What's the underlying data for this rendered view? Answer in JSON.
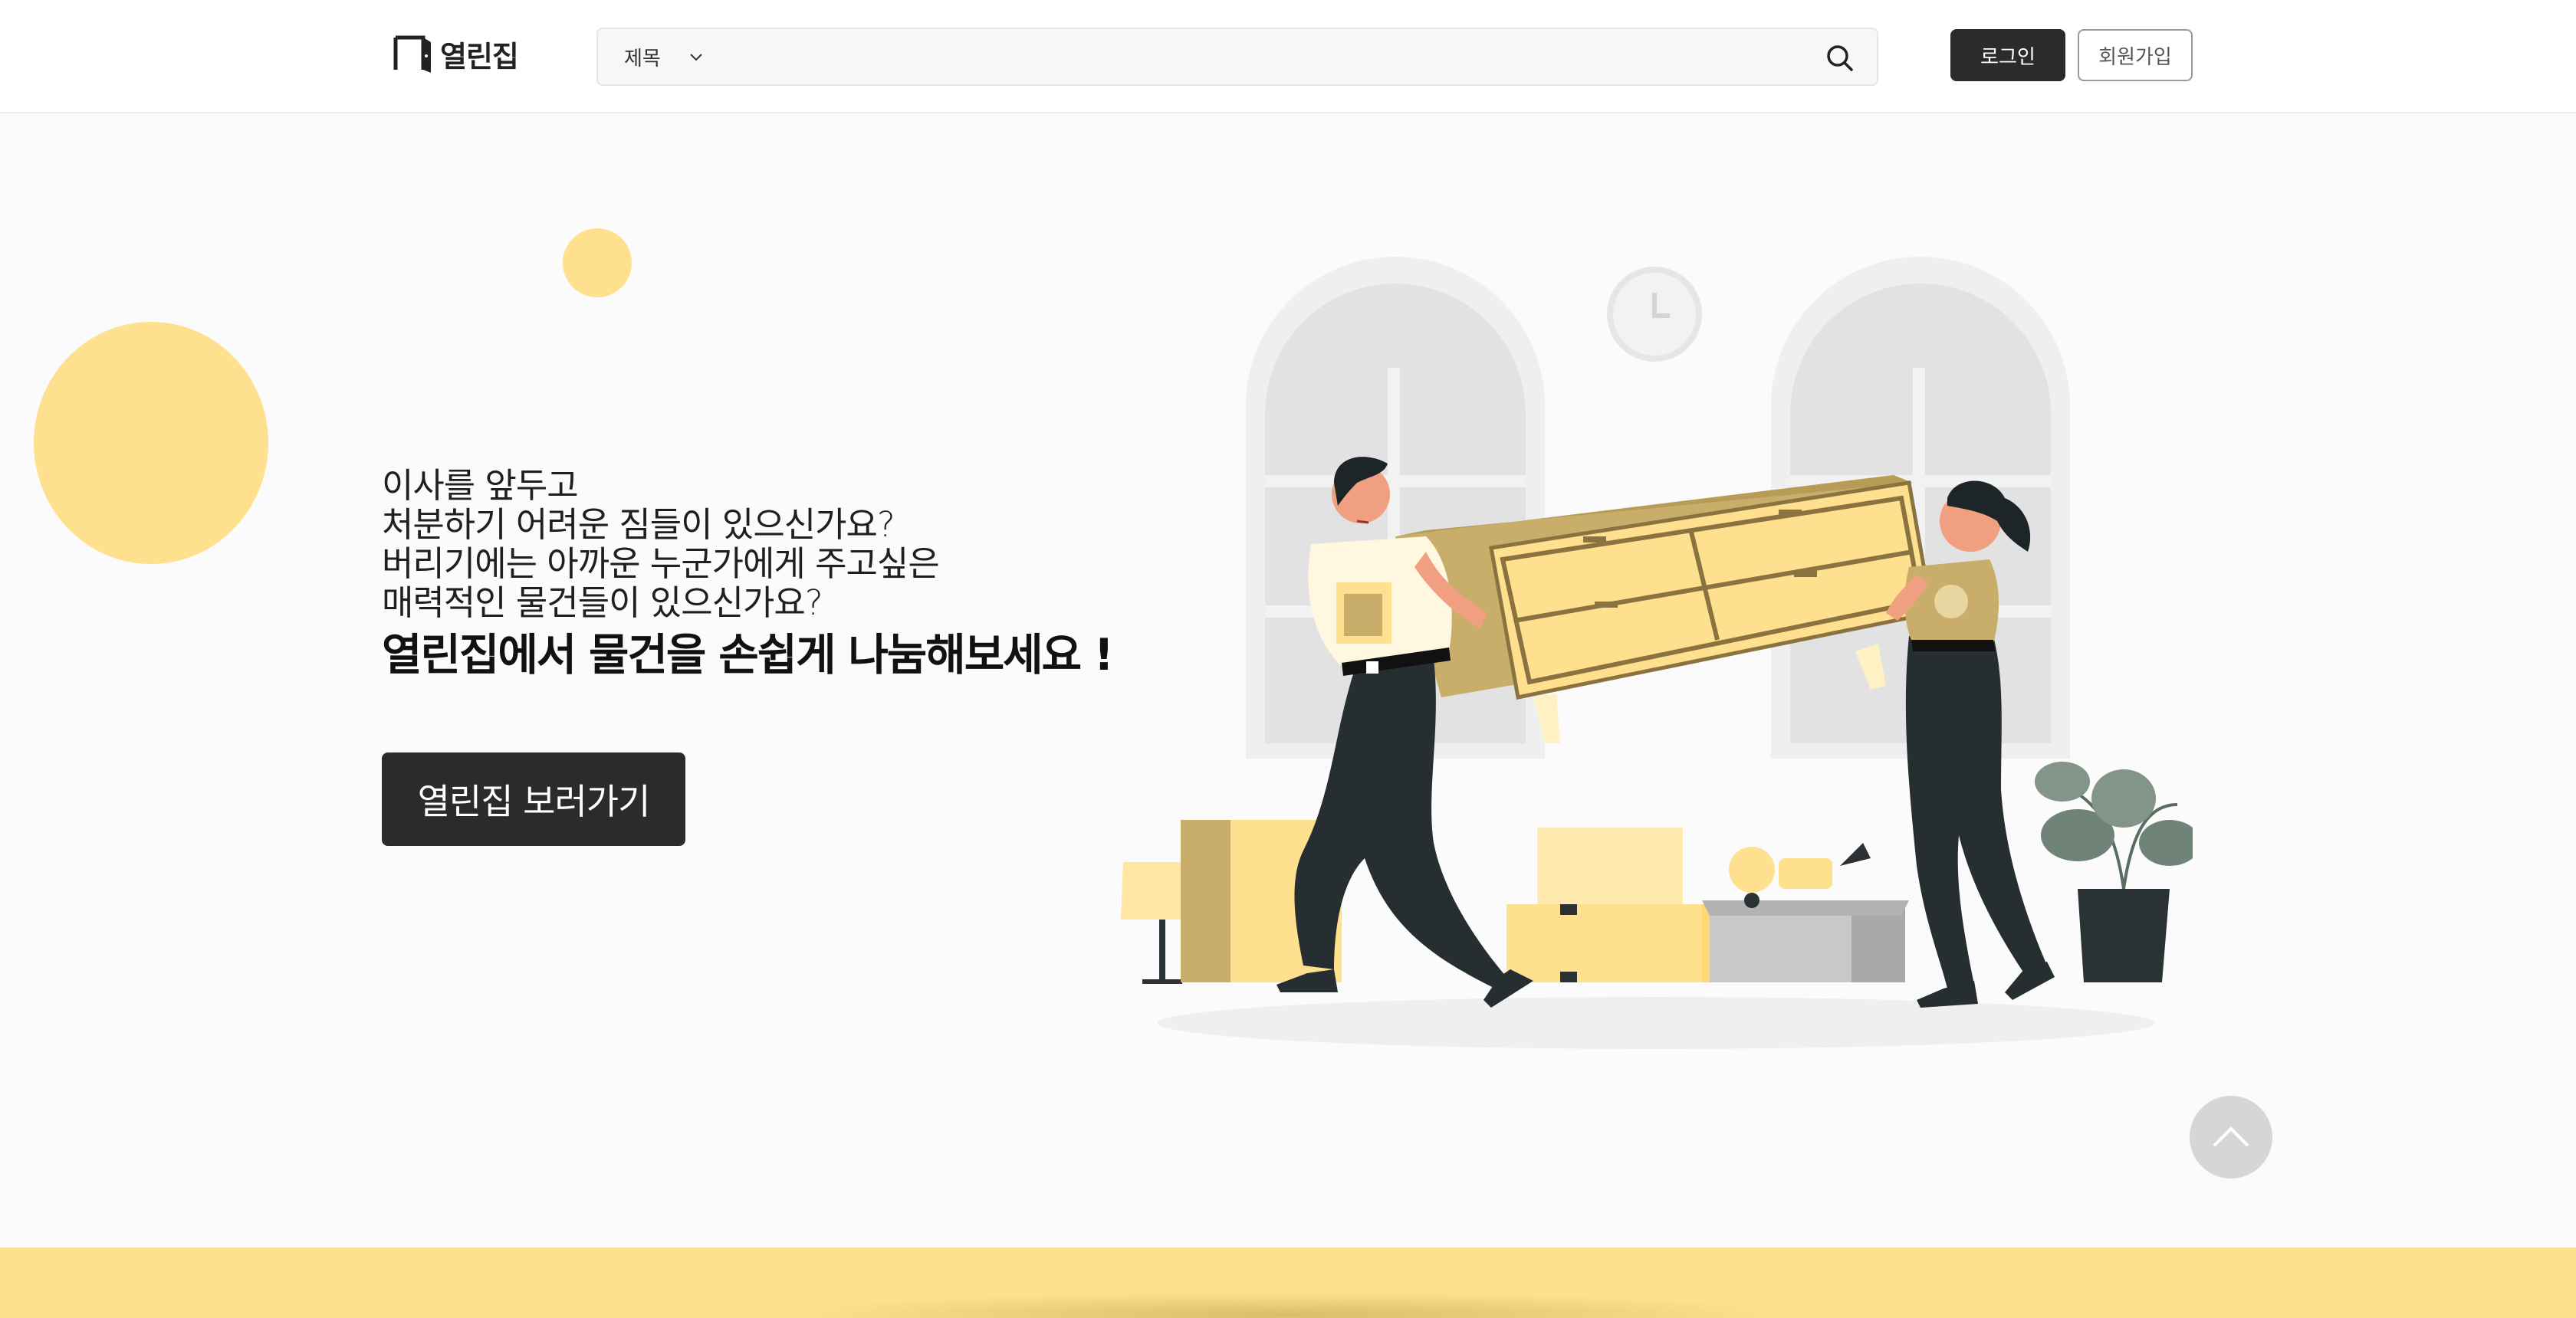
{
  "header": {
    "logo_text": "열린집",
    "search": {
      "select_value": "제목",
      "placeholder": ""
    },
    "login_label": "로그인",
    "join_label": "회원가입"
  },
  "hero": {
    "lines": [
      "이사를 앞두고",
      "처분하기 어려운 짐들이 있으신가요?",
      "버리기에는 아까운 누군가에게 주고싶은",
      "매력적인 물건들이 있으신가요?"
    ],
    "headline": "열린집에서 물건을 손쉽게 나눔해보세요 !",
    "cta_label": "열린집 보러가기"
  },
  "colors": {
    "accent_yellow": "#ffe08e",
    "dark": "#2b2b2b",
    "scroll_top_bg": "#d6d6d6"
  },
  "icons": {
    "search": "search-icon",
    "chevron": "chevron-down-icon",
    "scroll_top": "chevron-up-icon"
  }
}
